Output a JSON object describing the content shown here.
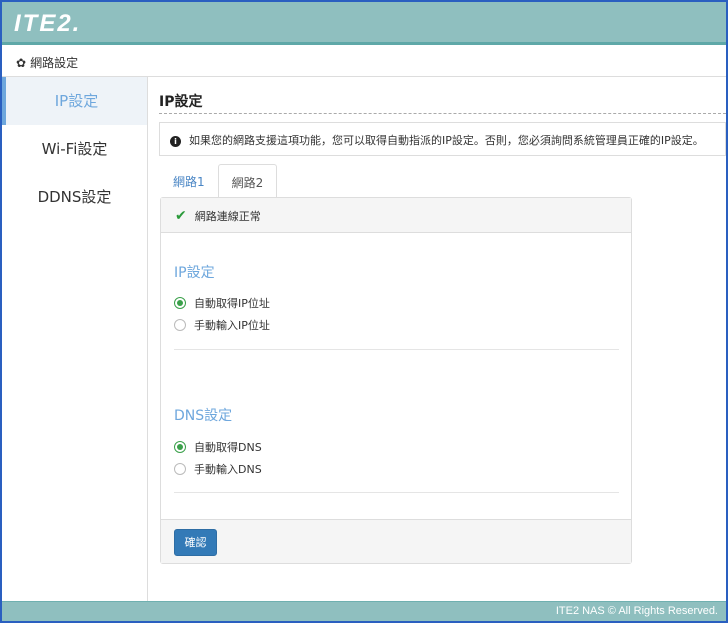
{
  "header": {
    "logo": "ITE2."
  },
  "breadcrumb": {
    "icon": "gear-icon",
    "label": "網路設定"
  },
  "sidebar": {
    "items": [
      {
        "label": "IP設定",
        "active": true
      },
      {
        "label": "Wi-Fi設定"
      },
      {
        "label": "DDNS設定"
      }
    ]
  },
  "main": {
    "title": "IP設定",
    "info": {
      "icon": "info-icon",
      "text": "如果您的網路支援這項功能，您可以取得自動指派的IP設定。否則，您必須詢問系統管理員正確的IP設定。"
    },
    "tabs": [
      {
        "label": "網路1"
      },
      {
        "label": "網路2",
        "active": true
      }
    ],
    "status": {
      "icon": "check-icon",
      "text": "網路連線正常",
      "color": "#2a9a3a"
    },
    "ip_section": {
      "title": "IP設定",
      "options": [
        {
          "label": "自動取得IP位址",
          "selected": true
        },
        {
          "label": "手動輸入IP位址",
          "selected": false
        }
      ]
    },
    "dns_section": {
      "title": "DNS設定",
      "options": [
        {
          "label": "自動取得DNS",
          "selected": true
        },
        {
          "label": "手動輸入DNS",
          "selected": false
        }
      ]
    },
    "confirm_label": "確認"
  },
  "footer": {
    "text": "ITE2 NAS © All Rights Reserved."
  }
}
